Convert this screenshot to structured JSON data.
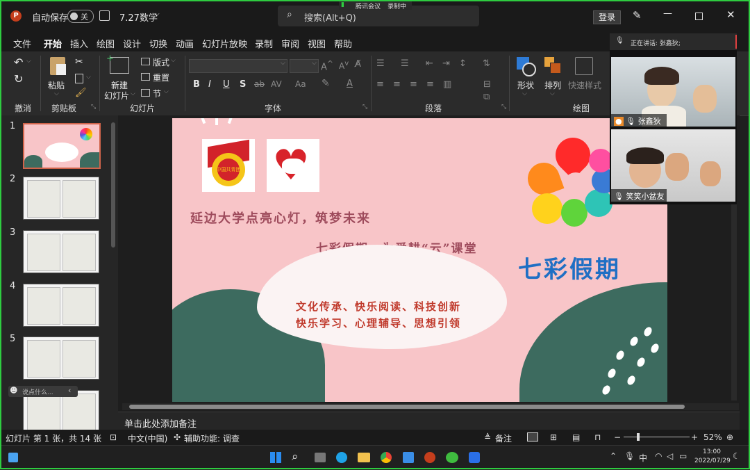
{
  "titlebar": {
    "autosave_label": "自动保存",
    "autosave_toggle": "关",
    "doc_title": "7.27数学",
    "search_placeholder": "搜索(Alt+Q)",
    "meeting_app": "腾讯会议",
    "recording": "录制中",
    "login": "登录"
  },
  "tabs": [
    "文件",
    "开始",
    "插入",
    "绘图",
    "设计",
    "切换",
    "动画",
    "幻灯片放映",
    "录制",
    "审阅",
    "视图",
    "帮助"
  ],
  "ribbon": {
    "undo_group": "撤消",
    "clipboard_group": "剪贴板",
    "paste": "粘贴",
    "slides_group": "幻灯片",
    "new_slide_1": "新建",
    "new_slide_2": "幻灯片",
    "layout": "版式",
    "reset": "重置",
    "section": "节",
    "font_group": "字体",
    "paragraph_group": "段落",
    "drawing_group": "绘图",
    "shapes": "形状",
    "arrange": "排列",
    "quick_styles": "快速样式"
  },
  "slides": {
    "numbers": [
      "1",
      "2",
      "3",
      "4",
      "5"
    ],
    "comment_hint": "说点什么..."
  },
  "slide": {
    "line1": "延边大学点亮心灯，筑梦未来",
    "line2": "七彩假期，为爱耕“云”课堂",
    "brand": "七彩假期",
    "body1": "文化传承、快乐阅读、科技创新",
    "body2": "快乐学习、心理辅导、思想引领",
    "emblem_text": "中国共青团"
  },
  "notes_placeholder": "单击此处添加备注",
  "status": {
    "slide_info": "幻灯片 第 1 张，共 14 张",
    "language": "中文(中国)",
    "accessibility": "辅助功能: 调查",
    "notes": "备注",
    "zoom": "52%"
  },
  "meeting": {
    "speaking": "正在讲话: 张鑫狄;",
    "participant1": "张鑫狄",
    "participant2": "笑笑小盆友"
  },
  "taskbar": {
    "ime": "中",
    "time": "13:00",
    "date": "2022/07/29"
  },
  "colors": {
    "accent_frame": "#2ecc40",
    "ppt_accent": "#c43e1c",
    "slide_bg": "#f8c5c8",
    "slide_dark_green": "#3d6b5f"
  }
}
